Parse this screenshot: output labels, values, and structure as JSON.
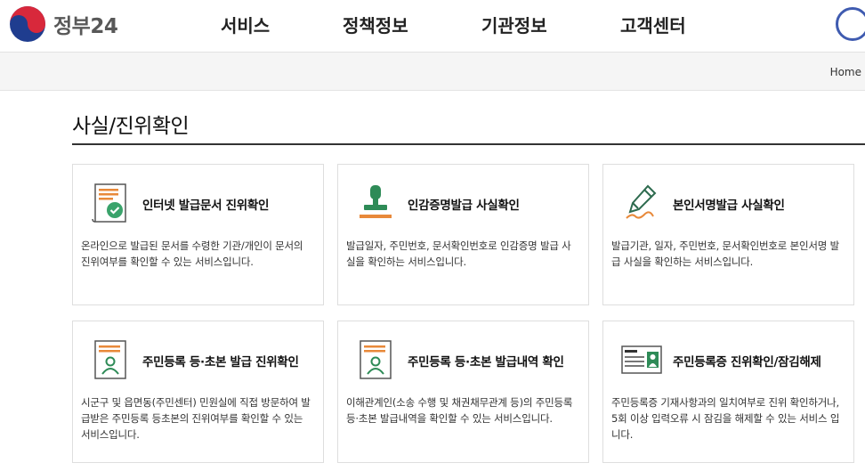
{
  "header": {
    "logo_text": "정부24",
    "nav": [
      "서비스",
      "정책정보",
      "기관정보",
      "고객센터"
    ]
  },
  "breadcrumb": {
    "home": "Home"
  },
  "page": {
    "title": "사실/진위확인"
  },
  "cards": [
    {
      "title": "인터넷 발급문서 진위확인",
      "desc": "온라인으로 발급된 문서를 수령한 기관/개인이 문서의 진위여부를 확인할 수 있는 서비스입니다.",
      "icon": "document-check-icon"
    },
    {
      "title": "인감증명발급 사실확인",
      "desc": "발급일자, 주민번호, 문서확인번호로 인감증명 발급 사실을 확인하는 서비스입니다.",
      "icon": "seal-stamp-icon"
    },
    {
      "title": "본인서명발급 사실확인",
      "desc": "발급기관, 일자, 주민번호, 문서확인번호로 본인서명 발급 사실을 확인하는 서비스입니다.",
      "icon": "pen-signature-icon"
    },
    {
      "title": "주민등록 등·초본 발급 진위확인",
      "desc": "시군구 및 읍면동(주민센터) 민원실에 직접 방문하여 발급받은 주민등록 등초본의 진위여부를 확인할 수 있는 서비스입니다.",
      "icon": "resident-document-icon"
    },
    {
      "title": "주민등록 등·초본 발급내역 확인",
      "desc": "이해관계인(소송 수행 및 채권채무관계 등)의 주민등록 등·초본 발급내역을 확인할 수 있는 서비스입니다.",
      "icon": "resident-history-icon"
    },
    {
      "title": "주민등록증 진위확인/잠김해제",
      "desc": "주민등록증 기재사항과의 일치여부로 진위 확인하거나, 5회 이상 입력오류 시 잠김을 해제할 수 있는 서비스 입니다.",
      "icon": "id-card-icon"
    }
  ]
}
